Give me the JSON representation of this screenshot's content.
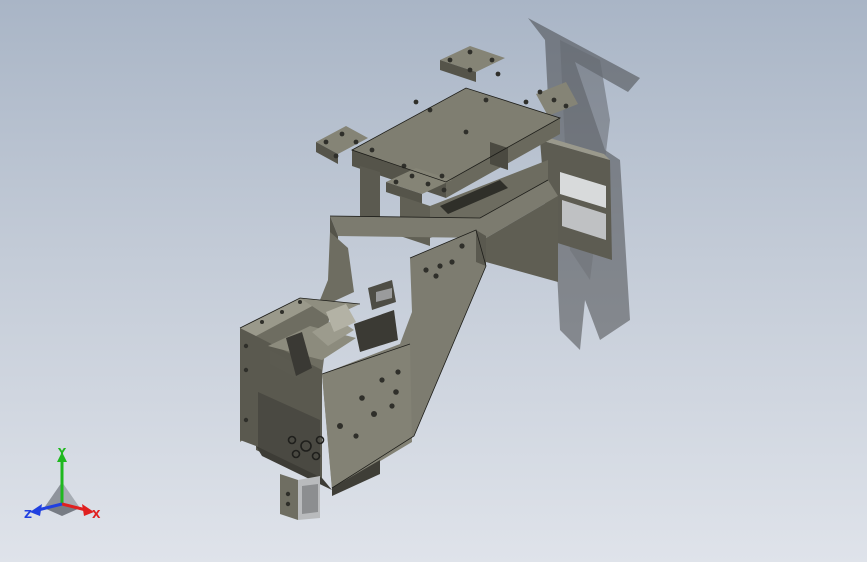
{
  "viewport": {
    "background_top": "#a9b5c6",
    "background_bottom": "#dfe3ea",
    "model": {
      "body_color": "#6f6e62",
      "face_color": "#8a897b",
      "shadow_color": "#2b2b2b",
      "rail_color": "#c9cbcc"
    }
  },
  "triad": {
    "x_label": "X",
    "y_label": "Y",
    "z_label": "Z",
    "x_color": "#e02020",
    "y_color": "#1fb81f",
    "z_color": "#2040e0"
  }
}
